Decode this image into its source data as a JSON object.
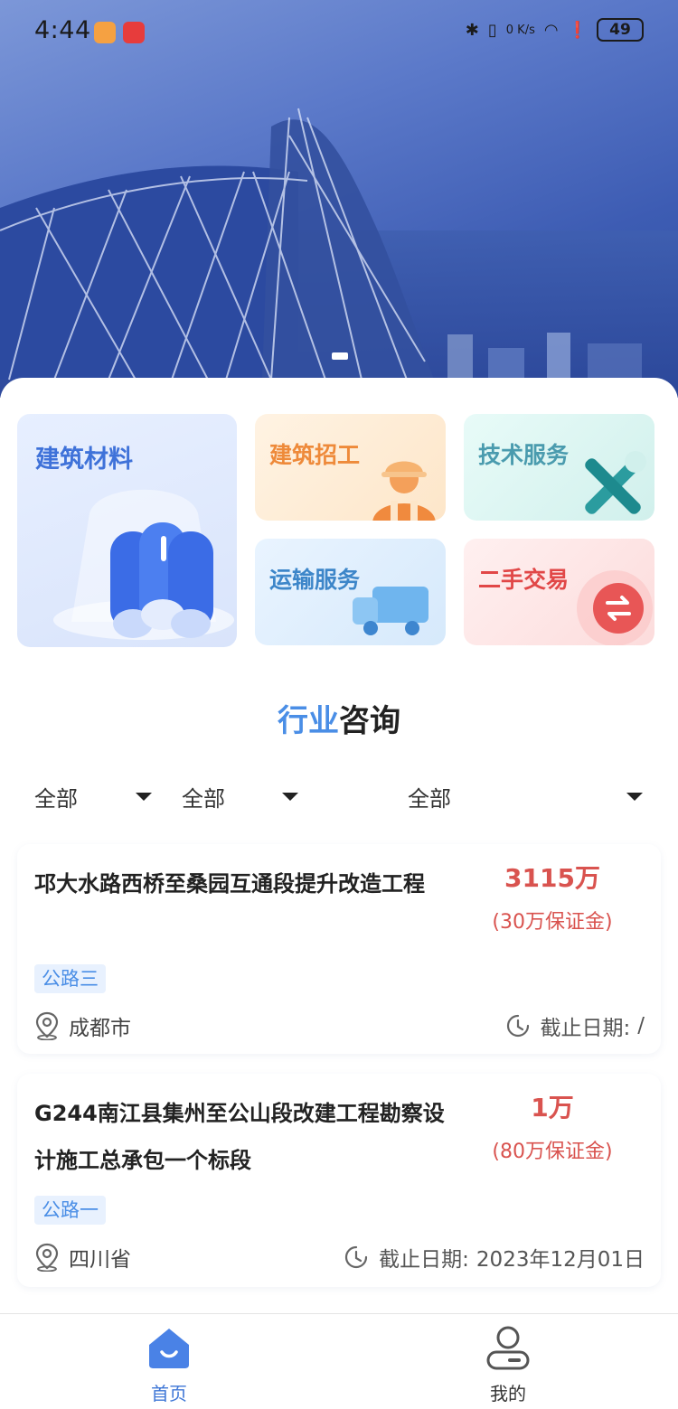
{
  "status_bar": {
    "time": "4:44",
    "network_speed": "0 K/s",
    "battery": "49"
  },
  "categories": [
    {
      "label": "建筑材料",
      "icon": "pipes-icon",
      "color": "#3f72d9"
    },
    {
      "label": "建筑招工",
      "icon": "worker-icon",
      "color": "#ee8a3a"
    },
    {
      "label": "技术服务",
      "icon": "tools-icon",
      "color": "#4a9bae"
    },
    {
      "label": "运输服务",
      "icon": "truck-icon",
      "color": "#3d86c9"
    },
    {
      "label": "二手交易",
      "icon": "exchange-icon",
      "color": "#e14747"
    }
  ],
  "section": {
    "title_accent": "行业",
    "title_rest": "咨询"
  },
  "filters": [
    {
      "label": "全部"
    },
    {
      "label": "全部"
    },
    {
      "label": "全部"
    }
  ],
  "items": [
    {
      "title": "邛大水路西桥至桑园互通段提升改造工程",
      "amount": "3115万",
      "deposit": "(30万保证金)",
      "tag": "公路三",
      "location": "成都市",
      "deadline_label": "截止日期:",
      "deadline": "/"
    },
    {
      "title": "G244南江县集州至公山段改建工程勘察设计施工总承包一个标段",
      "amount": "1万",
      "deposit": "(80万保证金)",
      "tag": "公路一",
      "location": "四川省",
      "deadline_label": "截止日期:",
      "deadline": "2023年12月01日"
    }
  ],
  "bottom_nav": [
    {
      "label": "首页",
      "icon": "home-icon",
      "active": true
    },
    {
      "label": "我的",
      "icon": "user-icon",
      "active": false
    }
  ],
  "colors": {
    "accent": "#4a8ee6",
    "price": "#d9534f",
    "nav_active": "#3e76d6"
  }
}
